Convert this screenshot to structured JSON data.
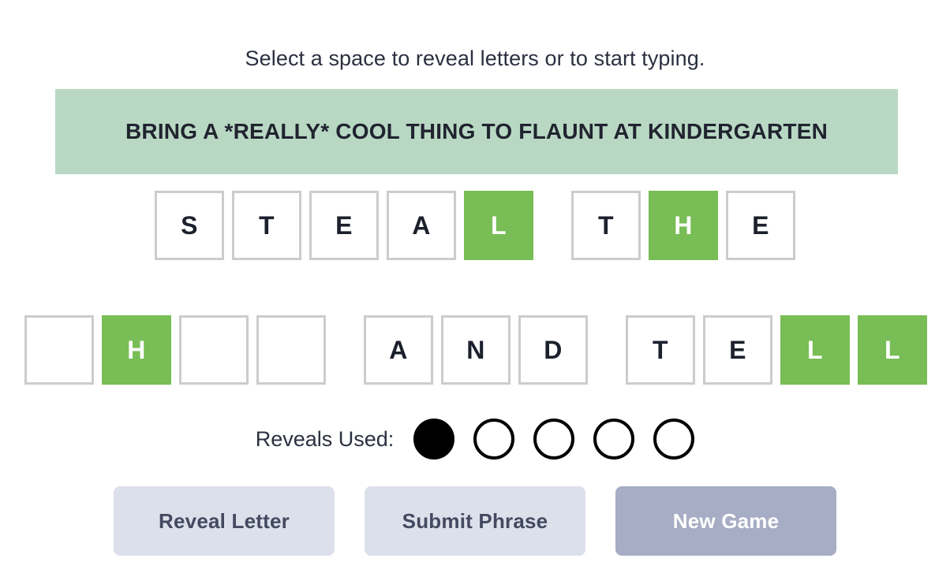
{
  "instruction": "Select a space to reveal letters or to start typing.",
  "phrase_banner": {
    "text": "BRING A *REALLY* COOL THING TO FLAUNT AT KINDERGARTEN",
    "background_color": "#b9d8c4"
  },
  "board": {
    "revealed_color": "#78bd55",
    "tile_border_color": "#cccccc",
    "rows": [
      {
        "words": [
          {
            "tiles": [
              {
                "letter": "S",
                "revealed": false
              },
              {
                "letter": "T",
                "revealed": false
              },
              {
                "letter": "E",
                "revealed": false
              },
              {
                "letter": "A",
                "revealed": false
              },
              {
                "letter": "L",
                "revealed": true
              }
            ]
          },
          {
            "tiles": [
              {
                "letter": "T",
                "revealed": false
              },
              {
                "letter": "H",
                "revealed": true
              },
              {
                "letter": "E",
                "revealed": false
              }
            ]
          }
        ]
      },
      {
        "words": [
          {
            "tiles": [
              {
                "letter": "",
                "revealed": false
              },
              {
                "letter": "H",
                "revealed": true
              },
              {
                "letter": "",
                "revealed": false
              },
              {
                "letter": "",
                "revealed": false
              }
            ]
          },
          {
            "tiles": [
              {
                "letter": "A",
                "revealed": false
              },
              {
                "letter": "N",
                "revealed": false
              },
              {
                "letter": "D",
                "revealed": false
              }
            ]
          },
          {
            "tiles": [
              {
                "letter": "T",
                "revealed": false
              },
              {
                "letter": "E",
                "revealed": false
              },
              {
                "letter": "L",
                "revealed": true
              },
              {
                "letter": "L",
                "revealed": true
              }
            ]
          }
        ]
      }
    ]
  },
  "reveals": {
    "label": "Reveals Used:",
    "total": 5,
    "used": 1
  },
  "buttons": [
    {
      "label": "Reveal Letter",
      "style": "secondary"
    },
    {
      "label": "Submit Phrase",
      "style": "secondary"
    },
    {
      "label": "New Game",
      "style": "primary"
    }
  ]
}
